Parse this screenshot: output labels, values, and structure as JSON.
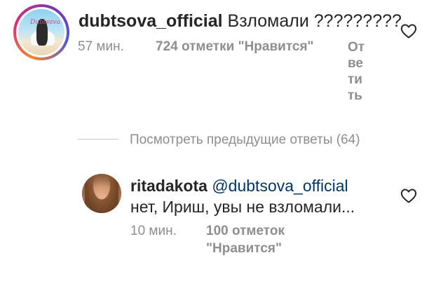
{
  "comment": {
    "username": "dubtsova_official",
    "text": "Взломали ?????????",
    "time": "57 мин.",
    "likes": "724 отметки \"Нравится\"",
    "reply": "Ответить",
    "avatar_caption": "Dubtsova",
    "avatar_icon": "profile-photo"
  },
  "view_replies": "Посмотреть предыдущие ответы (64)",
  "reply": {
    "username": "ritadakota",
    "mention": "@dubtsova_official",
    "text": "нет, Ириш, увы не взломали...",
    "time": "10 мин.",
    "likes": "100 отметок \"Нравится\"",
    "avatar_icon": "profile-photo"
  },
  "icons": {
    "like": "heart-outline-icon"
  },
  "colors": {
    "text": "#262626",
    "meta": "#8e8e8e",
    "mention": "#00376b",
    "divider": "#c7c7c7"
  }
}
